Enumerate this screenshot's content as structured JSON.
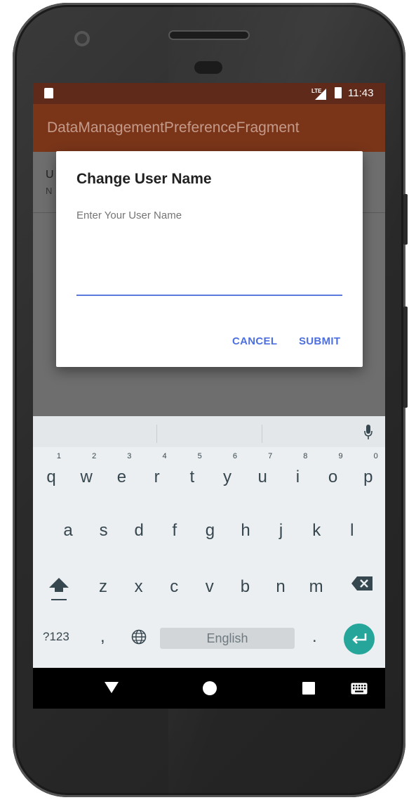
{
  "status_bar": {
    "network": "LTE",
    "time": "11:43"
  },
  "app_bar": {
    "title": "DataManagementPreferenceFragment"
  },
  "preference": {
    "title": "U",
    "summary": "N"
  },
  "dialog": {
    "title": "Change User Name",
    "message": "Enter Your User Name",
    "input_value": "",
    "cancel_label": "CANCEL",
    "submit_label": "SUBMIT",
    "accent_color": "#4d6fe0"
  },
  "keyboard": {
    "row1": [
      {
        "key": "q",
        "hint": "1"
      },
      {
        "key": "w",
        "hint": "2"
      },
      {
        "key": "e",
        "hint": "3"
      },
      {
        "key": "r",
        "hint": "4"
      },
      {
        "key": "t",
        "hint": "5"
      },
      {
        "key": "y",
        "hint": "6"
      },
      {
        "key": "u",
        "hint": "7"
      },
      {
        "key": "i",
        "hint": "8"
      },
      {
        "key": "o",
        "hint": "9"
      },
      {
        "key": "p",
        "hint": "0"
      }
    ],
    "row2": [
      "a",
      "s",
      "d",
      "f",
      "g",
      "h",
      "j",
      "k",
      "l"
    ],
    "row3": [
      "z",
      "x",
      "c",
      "v",
      "b",
      "n",
      "m"
    ],
    "symbols_label": "?123",
    "comma": ",",
    "period": ".",
    "space_label": "English",
    "enter_color": "#26a69a"
  },
  "icons": [
    "sd-card-icon",
    "lte-signal-icon",
    "battery-charging-icon",
    "microphone-icon",
    "shift-icon",
    "backspace-icon",
    "globe-icon",
    "enter-icon",
    "back-icon",
    "home-icon",
    "recents-icon",
    "keyboard-icon"
  ]
}
